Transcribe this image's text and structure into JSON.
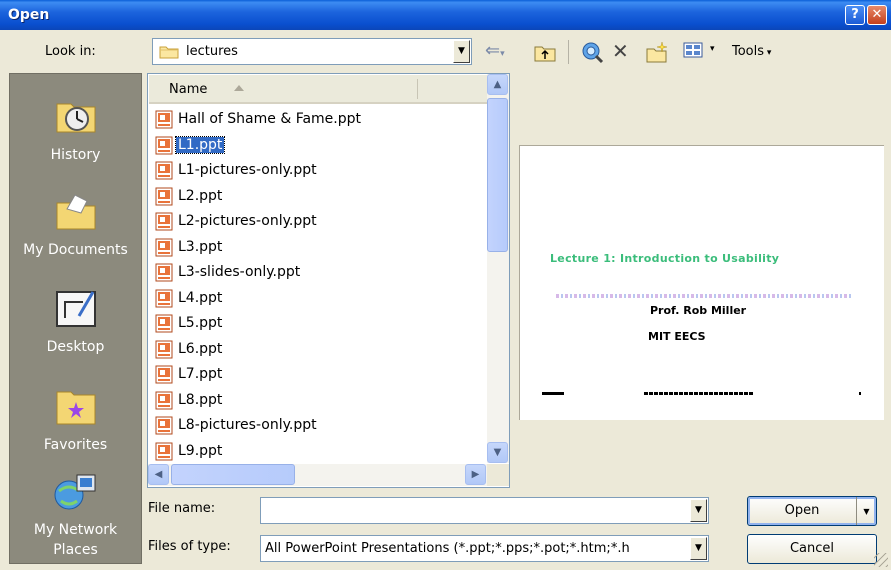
{
  "window": {
    "title": "Open",
    "help_glyph": "?",
    "close_glyph": "✕"
  },
  "toolbar": {
    "look_in_label": "Look in:",
    "look_in_value": "lectures",
    "tools_label": "Tools"
  },
  "places": [
    {
      "label": "History"
    },
    {
      "label": "My Documents"
    },
    {
      "label": "Desktop"
    },
    {
      "label": "Favorites"
    },
    {
      "label": "My Network Places"
    }
  ],
  "file_list": {
    "column_header": "Name",
    "files": [
      "Hall of Shame & Fame.ppt",
      "L1.ppt",
      "L1-pictures-only.ppt",
      "L2.ppt",
      "L2-pictures-only.ppt",
      "L3.ppt",
      "L3-slides-only.ppt",
      "L4.ppt",
      "L5.ppt",
      "L6.ppt",
      "L7.ppt",
      "L8.ppt",
      "L8-pictures-only.ppt",
      "L9.ppt"
    ],
    "selected": "L1.ppt"
  },
  "preview": {
    "title": "Lecture 1: Introduction to Usability",
    "author": "Prof. Rob Miller",
    "dept": "MIT EECS"
  },
  "form": {
    "file_name_label": "File name:",
    "file_name_value": "",
    "file_type_label": "Files of type:",
    "file_type_value": "All PowerPoint Presentations (*.ppt;*.pps;*.pot;*.htm;*.h"
  },
  "buttons": {
    "open": "Open",
    "cancel": "Cancel"
  },
  "colors": {
    "title_bar": "#0a4fcf",
    "selection": "#316ac5",
    "places_bg": "#8c8a7d",
    "dialog_bg": "#ece9d8"
  }
}
